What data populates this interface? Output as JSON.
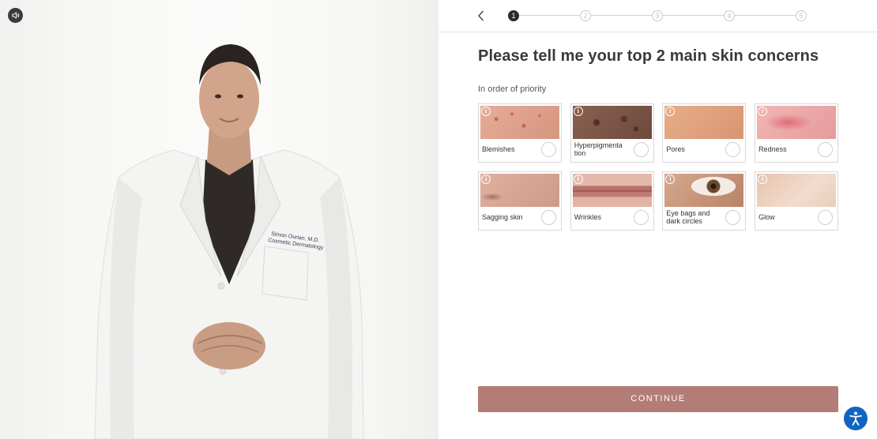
{
  "video": {
    "sound_icon": "speaker-icon",
    "badge_name": "Simon Ourian, M.D.",
    "badge_title": "Cosmetic Dermatology"
  },
  "stepper": {
    "back_icon": "chevron-left-icon",
    "steps": [
      "1",
      "2",
      "3",
      "4",
      "5"
    ],
    "current_step": 1
  },
  "question": {
    "title": "Please tell me your top 2 main skin concerns",
    "subtitle": "In order of priority"
  },
  "concerns": [
    {
      "label": "Blemishes",
      "image": "blemishes-photo",
      "color": "#dca08c"
    },
    {
      "label": "Hyperpigmentation",
      "label_lines": [
        "Hyperpigmenta",
        "tion"
      ],
      "image": "hyperpigmentation-photo",
      "color": "#7a5444"
    },
    {
      "label": "Pores",
      "image": "pores-photo",
      "color": "#e1a27e"
    },
    {
      "label": "Redness",
      "image": "redness-photo",
      "color": "#e9a0a0"
    },
    {
      "label": "Sagging skin",
      "image": "sagging-skin-photo",
      "color": "#d4a08e"
    },
    {
      "label": "Wrinkles",
      "image": "wrinkles-photo",
      "color": "#c58074"
    },
    {
      "label": "Eye bags and dark circles",
      "label_lines": [
        "Eye bags and",
        "dark circles"
      ],
      "image": "eye-photo",
      "color": "#c29278"
    },
    {
      "label": "Glow",
      "image": "glow-photo",
      "color": "#e8cbb6"
    }
  ],
  "continue_label": "CONTINUE",
  "accessibility_icon": "accessibility-icon",
  "colors": {
    "accent": "#b47c76",
    "active_step": "#2b2b2b",
    "accessibility": "#1164c4"
  }
}
